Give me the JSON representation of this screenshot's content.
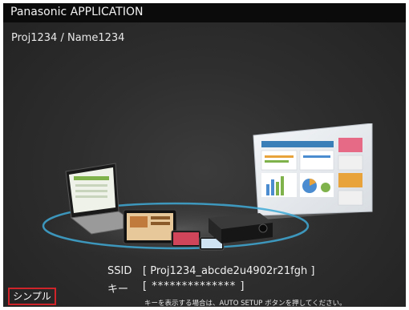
{
  "window": {
    "title": "Panasonic APPLICATION"
  },
  "project": {
    "path": "Proj1234 / Name1234"
  },
  "connection": {
    "ssid_label": "SSID",
    "ssid_value": "[ Proj1234_abcde2u4902r21fgh ]",
    "key_label": "キー",
    "key_value": "[ ************** ]",
    "hint": "キーを表示する場合は、AUTO SETUP ボタンを押してください。"
  },
  "footer": {
    "simple_button_label": "シンプル"
  },
  "colors": {
    "accent": "#d0242b",
    "title_bar": "#0b0b0b",
    "background": "#2e2e2e",
    "ring": "#3fa9d6"
  }
}
